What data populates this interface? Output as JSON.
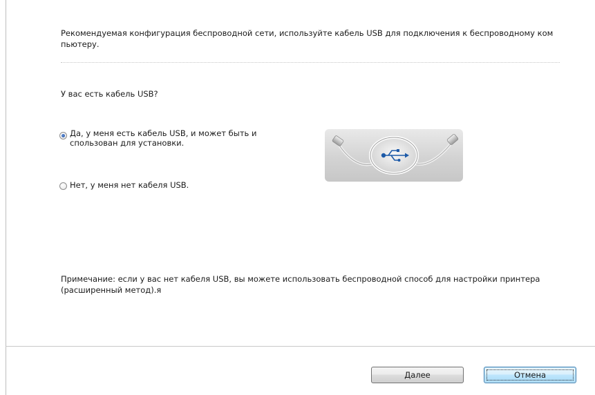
{
  "intro": {
    "text": "Рекомендуемая конфигурация беспроводной сети, используйте кабель USB для подключения к беспроводному ком пьютеру."
  },
  "question": {
    "text": "У вас есть кабель USB?"
  },
  "options": [
    {
      "label": "Да, у меня есть кабель USB, и может быть и спользован для установки.",
      "selected": true
    },
    {
      "label": "Нет, у меня нет кабеля USB.",
      "selected": false
    }
  ],
  "illustration": {
    "icon": "usb-cable-icon"
  },
  "note": {
    "text": "Примечание: если у вас нет кабеля USB, вы можете использовать беспроводной способ для настройки принтера (расширенный метод).я"
  },
  "buttons": {
    "next_label": "Далее",
    "cancel_label": "Отмена"
  },
  "colors": {
    "radio_selected": "#244f9e",
    "cancel_focus_border": "#3c7fb1",
    "panel_background": "#d3d3d3"
  }
}
